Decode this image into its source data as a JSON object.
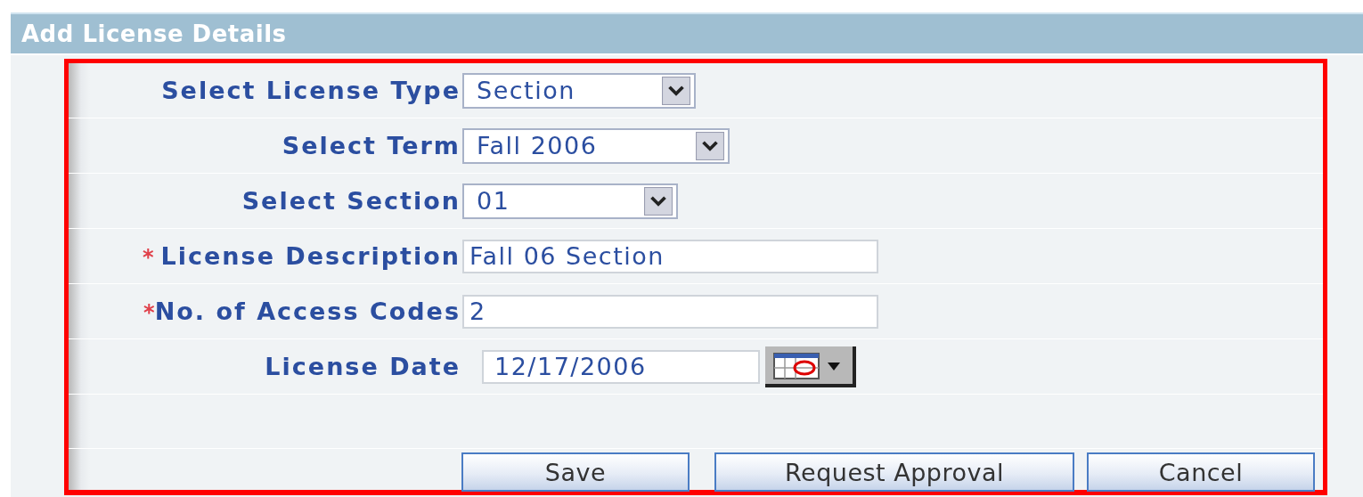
{
  "panel": {
    "title": "Add License Details"
  },
  "fields": [
    {
      "kind": "select",
      "label": "Select License Type",
      "required": false,
      "value": "Section"
    },
    {
      "kind": "select",
      "label": "Select Term",
      "required": false,
      "value": "Fall 2006"
    },
    {
      "kind": "select",
      "label": "Select Section",
      "required": false,
      "value": "01"
    },
    {
      "kind": "text",
      "label": "License Description",
      "required": true,
      "value": "Fall 06 Section"
    },
    {
      "kind": "text",
      "label": "No. of Access Codes",
      "required": true,
      "value": "2"
    },
    {
      "kind": "date",
      "label": "License Date",
      "required": false,
      "value": "12/17/2006"
    }
  ],
  "required_mark": "*",
  "buttons": [
    "Save",
    "Request Approval",
    "Cancel"
  ]
}
